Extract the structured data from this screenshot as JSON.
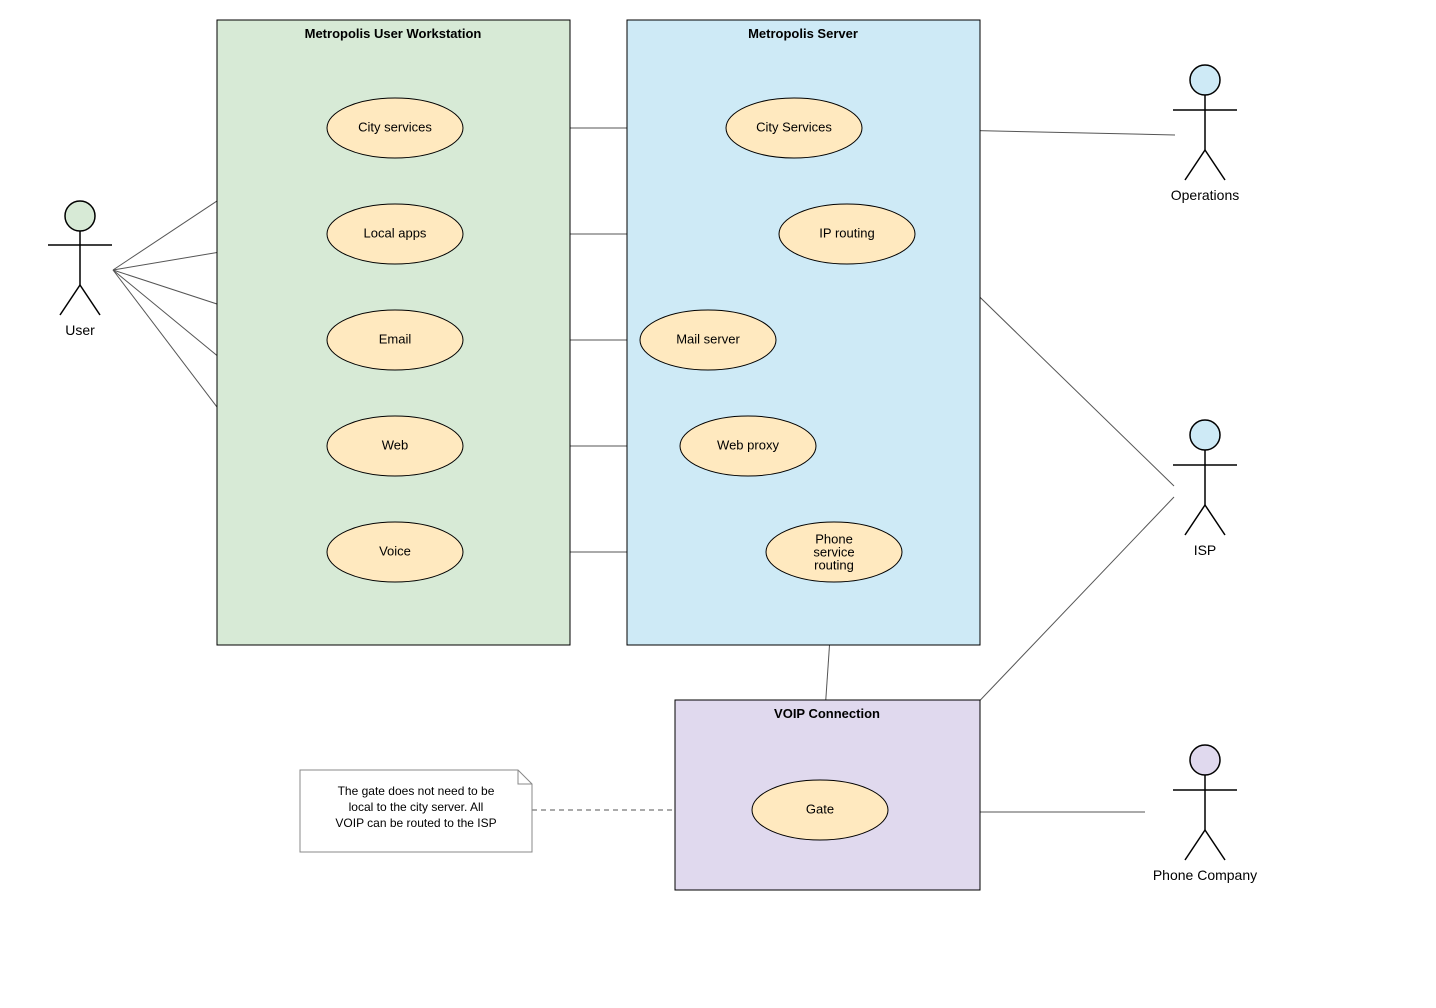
{
  "containers": {
    "workstation": {
      "title": "Metropolis User Workstation",
      "fill": "#d7ead6"
    },
    "server": {
      "title": "Metropolis Server",
      "fill": "#ceeaf6"
    },
    "voip": {
      "title": "VOIP Connection",
      "fill": "#e0d9ee"
    }
  },
  "workstation_usecases": {
    "city_services": "City services",
    "local_apps": "Local apps",
    "email": "Email",
    "web": "Web",
    "voice": "Voice"
  },
  "server_usecases": {
    "city_services": "City Services",
    "ip_routing": "IP routing",
    "mail_server": "Mail server",
    "web_proxy": "Web proxy",
    "phone_routing_l1": "Phone",
    "phone_routing_l2": "service",
    "phone_routing_l3": "routing"
  },
  "voip_usecase": {
    "gate": "Gate"
  },
  "actors": {
    "user": {
      "label": "User",
      "head_fill": "#d7ead6"
    },
    "operations": {
      "label": "Operations",
      "head_fill": "#ceeaf6"
    },
    "isp": {
      "label": "ISP",
      "head_fill": "#ceeaf6"
    },
    "phone": {
      "label": "Phone Company",
      "head_fill": "#e0d9ee"
    }
  },
  "note": {
    "line1": "The gate does not need to be",
    "line2": "local to the city server.  All",
    "line3": "VOIP can be routed to the ISP"
  }
}
